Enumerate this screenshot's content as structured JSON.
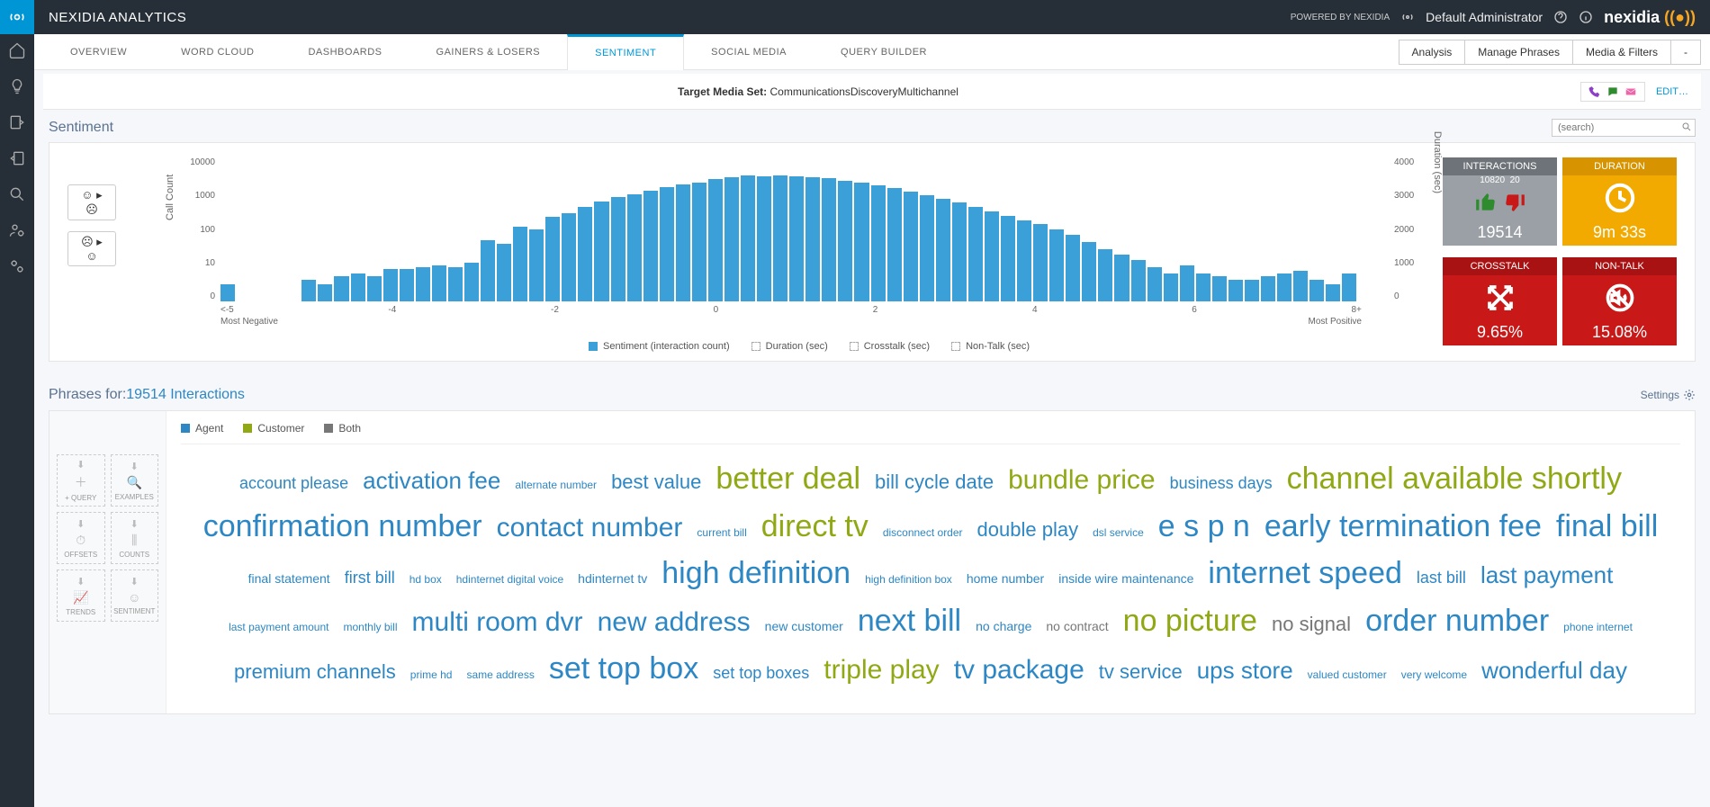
{
  "brand": "NEXIDIA ANALYTICS",
  "powered_by": "POWERED BY NEXIDIA",
  "user": "Default Administrator",
  "nexidia_logo_text": "nexidia",
  "tabs": [
    "OVERVIEW",
    "WORD CLOUD",
    "DASHBOARDS",
    "GAINERS & LOSERS",
    "SENTIMENT",
    "SOCIAL MEDIA",
    "QUERY BUILDER"
  ],
  "active_tab_index": 4,
  "action_buttons": [
    "Analysis",
    "Manage Phrases",
    "Media & Filters",
    "-"
  ],
  "target_media_set_label": "Target Media Set:",
  "target_media_set_value": "CommunicationsDiscoveryMultichannel",
  "edit_label": "EDIT…",
  "section_sentiment": "Sentiment",
  "search_placeholder": "(search)",
  "chart_y_label": "Call Count",
  "chart_y2_label": "Duration (sec)",
  "x_neg_label": "Most Negative",
  "x_pos_label": "Most Positive",
  "legend": {
    "sentiment": "Sentiment (interaction count)",
    "duration": "Duration (sec)",
    "crosstalk": "Crosstalk (sec)",
    "nontalk": "Non-Talk (sec)"
  },
  "tiles": {
    "interactions": {
      "title": "INTERACTIONS",
      "sub_left": "10820",
      "sub_right": "20",
      "foot": "19514"
    },
    "duration": {
      "title": "DURATION",
      "foot": "9m 33s"
    },
    "crosstalk": {
      "title": "CROSSTALK",
      "foot": "9.65%"
    },
    "nontalk": {
      "title": "NON-TALK",
      "foot": "15.08%"
    }
  },
  "phrases_title_prefix": "Phrases for:",
  "phrases_title_value": "19514 Interactions",
  "settings_label": "Settings",
  "cloud_legend": {
    "agent": "Agent",
    "customer": "Customer",
    "both": "Both"
  },
  "tool_labels": [
    "+ QUERY",
    "EXAMPLES",
    "OFFSETS",
    "COUNTS",
    "TRENDS",
    "SENTIMENT"
  ],
  "chart_data": {
    "type": "bar",
    "xlabel_left": "Most Negative",
    "xlabel_right": "Most Positive",
    "ylabel": "Call Count",
    "y2label": "Duration (sec)",
    "y_scale": "log",
    "y_ticks": [
      0,
      10,
      100,
      1000,
      10000
    ],
    "y2_ticks": [
      0,
      1000,
      2000,
      3000,
      4000
    ],
    "x_tick_labels": [
      "<-5",
      "-4",
      "-2",
      "0",
      "2",
      "4",
      "6",
      "8+"
    ],
    "series": [
      {
        "name": "Sentiment (interaction count)",
        "values": [
          3,
          0,
          0,
          0,
          0,
          4,
          3,
          5,
          6,
          5,
          8,
          8,
          9,
          10,
          9,
          12,
          50,
          40,
          120,
          100,
          220,
          280,
          420,
          600,
          800,
          950,
          1200,
          1500,
          1800,
          2000,
          2500,
          2800,
          3100,
          3000,
          3200,
          3000,
          2900,
          2600,
          2300,
          2000,
          1700,
          1400,
          1100,
          900,
          700,
          550,
          420,
          320,
          240,
          180,
          140,
          100,
          70,
          45,
          28,
          20,
          14,
          9,
          6,
          10,
          6,
          5,
          4,
          4,
          5,
          6,
          7,
          4,
          3,
          6,
          0,
          0
        ]
      }
    ]
  },
  "words": [
    {
      "t": "account please",
      "c": "a",
      "s": 5
    },
    {
      "t": "activation fee",
      "c": "a",
      "s": 3
    },
    {
      "t": "alternate number",
      "c": "a",
      "s": 7
    },
    {
      "t": "best value",
      "c": "a",
      "s": 4
    },
    {
      "t": "better deal",
      "c": "c",
      "s": 1
    },
    {
      "t": "bill cycle date",
      "c": "a",
      "s": 4
    },
    {
      "t": "bundle price",
      "c": "c",
      "s": 2
    },
    {
      "t": "business days",
      "c": "a",
      "s": 5
    },
    {
      "t": "channel available shortly",
      "c": "c",
      "s": 1
    },
    {
      "t": "confirmation number",
      "c": "a",
      "s": 1
    },
    {
      "t": "contact number",
      "c": "a",
      "s": 2
    },
    {
      "t": "current bill",
      "c": "a",
      "s": 7
    },
    {
      "t": "direct tv",
      "c": "c",
      "s": 1
    },
    {
      "t": "disconnect order",
      "c": "a",
      "s": 7
    },
    {
      "t": "double play",
      "c": "a",
      "s": 4
    },
    {
      "t": "dsl service",
      "c": "a",
      "s": 7
    },
    {
      "t": "e s p n",
      "c": "a",
      "s": 1
    },
    {
      "t": "early termination fee",
      "c": "a",
      "s": 1
    },
    {
      "t": "final bill",
      "c": "a",
      "s": 1
    },
    {
      "t": "final statement",
      "c": "a",
      "s": 6
    },
    {
      "t": "first bill",
      "c": "a",
      "s": 5
    },
    {
      "t": "hd box",
      "c": "a",
      "s": 7
    },
    {
      "t": "hdinternet digital voice",
      "c": "a",
      "s": 7
    },
    {
      "t": "hdinternet tv",
      "c": "a",
      "s": 6
    },
    {
      "t": "high definition",
      "c": "a",
      "s": 1
    },
    {
      "t": "high definition box",
      "c": "a",
      "s": 7
    },
    {
      "t": "home number",
      "c": "a",
      "s": 6
    },
    {
      "t": "inside wire maintenance",
      "c": "a",
      "s": 6
    },
    {
      "t": "internet speed",
      "c": "a",
      "s": 1
    },
    {
      "t": "last bill",
      "c": "a",
      "s": 5
    },
    {
      "t": "last payment",
      "c": "a",
      "s": 3
    },
    {
      "t": "last payment amount",
      "c": "a",
      "s": 7
    },
    {
      "t": "monthly bill",
      "c": "a",
      "s": 7
    },
    {
      "t": "multi room dvr",
      "c": "a",
      "s": 2
    },
    {
      "t": "new address",
      "c": "a",
      "s": 2
    },
    {
      "t": "new customer",
      "c": "a",
      "s": 6
    },
    {
      "t": "next bill",
      "c": "a",
      "s": 1
    },
    {
      "t": "no charge",
      "c": "a",
      "s": 6
    },
    {
      "t": "no contract",
      "c": "b",
      "s": 6
    },
    {
      "t": "no picture",
      "c": "c",
      "s": 1
    },
    {
      "t": "no signal",
      "c": "b",
      "s": 4
    },
    {
      "t": "order number",
      "c": "a",
      "s": 1
    },
    {
      "t": "phone internet",
      "c": "a",
      "s": 7
    },
    {
      "t": "premium channels",
      "c": "a",
      "s": 4
    },
    {
      "t": "prime hd",
      "c": "a",
      "s": 7
    },
    {
      "t": "same address",
      "c": "a",
      "s": 7
    },
    {
      "t": "set top box",
      "c": "a",
      "s": 1
    },
    {
      "t": "set top boxes",
      "c": "a",
      "s": 5
    },
    {
      "t": "triple play",
      "c": "c",
      "s": 2
    },
    {
      "t": "tv package",
      "c": "a",
      "s": 2
    },
    {
      "t": "tv service",
      "c": "a",
      "s": 4
    },
    {
      "t": "ups store",
      "c": "a",
      "s": 3
    },
    {
      "t": "valued customer",
      "c": "a",
      "s": 7
    },
    {
      "t": "very welcome",
      "c": "a",
      "s": 7
    },
    {
      "t": "wonderful day",
      "c": "a",
      "s": 3
    }
  ]
}
